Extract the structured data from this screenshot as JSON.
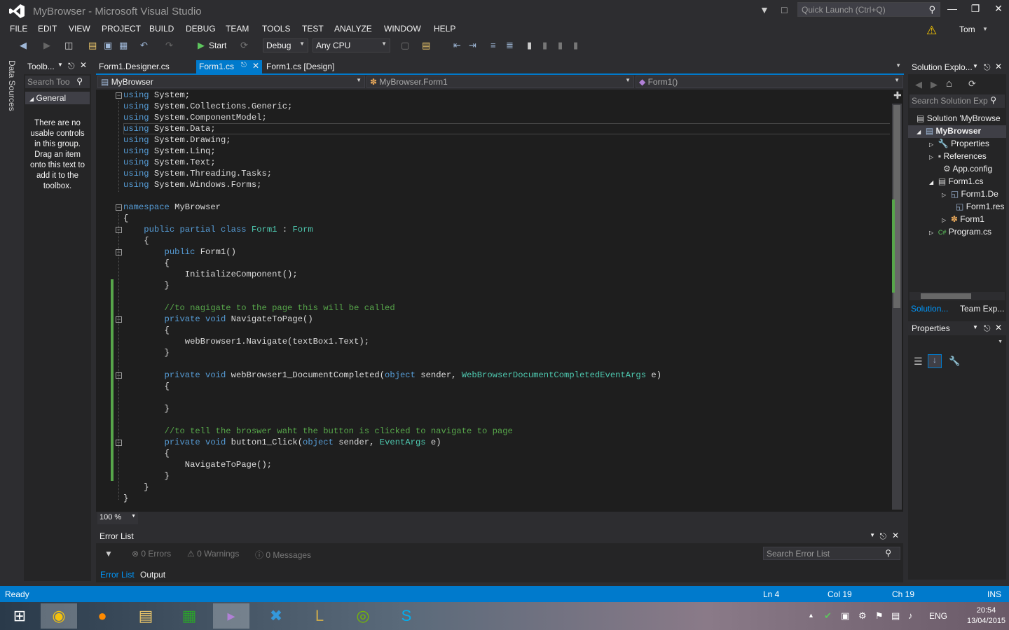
{
  "window": {
    "title": "MyBrowser - Microsoft Visual Studio",
    "quick_launch": "Quick Launch (Ctrl+Q)",
    "user": "Tom"
  },
  "menu": [
    "FILE",
    "EDIT",
    "VIEW",
    "PROJECT",
    "BUILD",
    "DEBUG",
    "TEAM",
    "TOOLS",
    "TEST",
    "ANALYZE",
    "WINDOW",
    "HELP"
  ],
  "toolbar": {
    "start": "Start",
    "config": "Debug",
    "platform": "Any CPU"
  },
  "toolbox": {
    "title": "Toolb...",
    "search": "Search Too",
    "group": "General",
    "message": "There are no usable controls in this group. Drag an item onto this text to add it to the toolbox."
  },
  "side_tab": "Data Sources",
  "tabs": [
    "Form1.Designer.cs",
    "Form1.cs",
    "Form1.cs [Design]"
  ],
  "nav": {
    "project": "MyBrowser",
    "class": "MyBrowser.Form1",
    "member": "Form1()"
  },
  "zoom": "100 %",
  "error_list": {
    "title": "Error List",
    "errors": "0 Errors",
    "warnings": "0 Warnings",
    "messages": "0 Messages",
    "search": "Search Error List",
    "tab_errors": "Error List",
    "tab_output": "Output"
  },
  "solution_explorer": {
    "title": "Solution Explo...",
    "search": "Search Solution Exp",
    "items": [
      "Solution 'MyBrowse",
      "MyBrowser",
      "Properties",
      "References",
      "App.config",
      "Form1.cs",
      "Form1.De",
      "Form1.res",
      "Form1",
      "Program.cs"
    ],
    "tab_solution": "Solution...",
    "tab_team": "Team Exp..."
  },
  "properties": {
    "title": "Properties"
  },
  "status": {
    "ready": "Ready",
    "ln": "Ln 4",
    "col": "Col 19",
    "ch": "Ch 19",
    "ins": "INS"
  },
  "tray": {
    "lang": "ENG",
    "time": "20:54",
    "date": "13/04/2015"
  }
}
